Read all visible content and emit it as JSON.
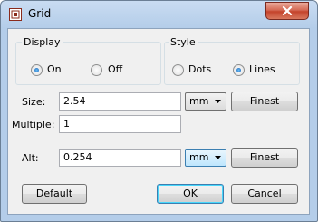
{
  "window": {
    "title": "Grid",
    "app_icon": "pcb-grid-icon",
    "close_icon": "close-icon"
  },
  "display": {
    "label": "Display",
    "options": [
      {
        "label": "On",
        "selected": true
      },
      {
        "label": "Off",
        "selected": false
      }
    ]
  },
  "style": {
    "label": "Style",
    "options": [
      {
        "label": "Dots",
        "selected": false
      },
      {
        "label": "Lines",
        "selected": true
      }
    ]
  },
  "size": {
    "label": "Size:",
    "value": "2.54",
    "unit": "mm",
    "button": "Finest"
  },
  "multiple": {
    "label": "Multiple:",
    "value": "1"
  },
  "alt": {
    "label": "Alt:",
    "value": "0.254",
    "unit": "mm",
    "button": "Finest"
  },
  "buttons": {
    "default": "Default",
    "ok": "OK",
    "cancel": "Cancel"
  },
  "colors": {
    "accent": "#3c7fb1",
    "close": "#c4432b",
    "titlebar": "#b4cde9"
  }
}
